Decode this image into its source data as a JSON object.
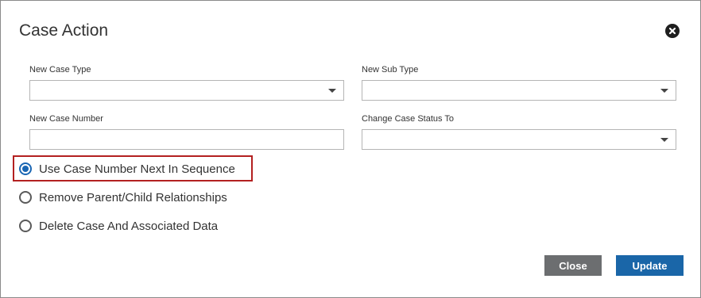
{
  "dialog": {
    "title": "Case Action",
    "close_icon": "close-circle-icon"
  },
  "fields": {
    "new_case_type": {
      "label": "New Case Type",
      "value": ""
    },
    "new_sub_type": {
      "label": "New Sub Type",
      "value": ""
    },
    "new_case_number": {
      "label": "New Case Number",
      "value": "",
      "placeholder": ""
    },
    "change_case_status": {
      "label": "Change Case Status To",
      "value": ""
    }
  },
  "options": [
    {
      "label": "Use Case Number Next In Sequence",
      "checked": true
    },
    {
      "label": "Remove Parent/Child Relationships",
      "checked": false
    },
    {
      "label": "Delete Case And Associated Data",
      "checked": false
    }
  ],
  "buttons": {
    "close_label": "Close",
    "update_label": "Update"
  },
  "colors": {
    "accent": "#1a66b3",
    "highlight": "#b32020",
    "close_button": "#6c6e70",
    "update_button": "#1a66a8"
  }
}
